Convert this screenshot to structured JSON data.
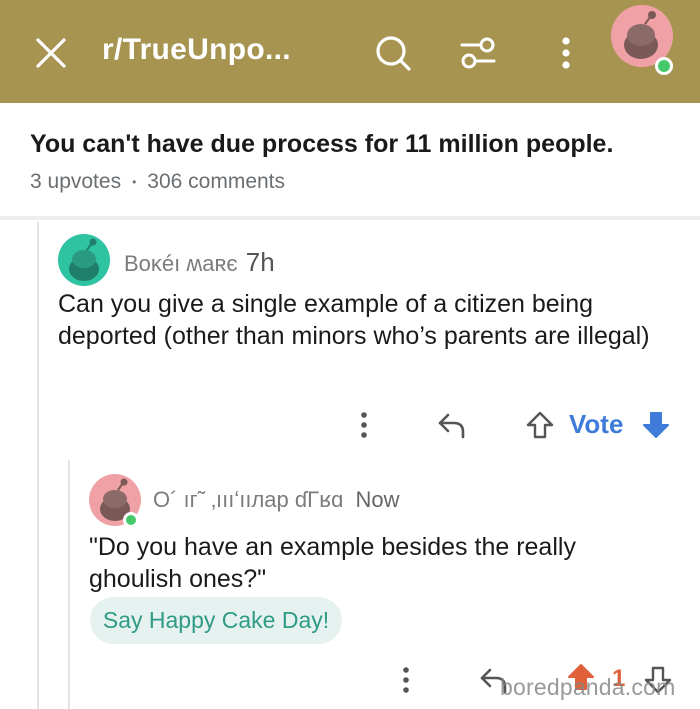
{
  "header": {
    "title": "r/TrueUnpo...",
    "close_icon": "close-icon",
    "search_icon": "search-icon",
    "filter_icon": "filter-icon",
    "more_icon": "more-vertical-icon",
    "bg_color": "#a69450"
  },
  "post": {
    "title": "You can't have due process for 11 million people.",
    "upvotes": "3 upvotes",
    "separator": "•",
    "comments": "306 comments"
  },
  "comment1": {
    "author": "Boĸéı ʍаʀє",
    "time": "7h",
    "text": "Can you give a single example of a citizen being deported (other than minors who’s parents are illegal)",
    "vote_label": "Vote",
    "avatar_color": "#2ec3a1"
  },
  "comment2": {
    "author": "O´ ıг˜  ‚ıııʻııлар ɗΓʁɑ",
    "time": "Now",
    "text": "\"Do you have an example besides the really ghoulish ones?\"",
    "cake_day": "Say Happy Cake Day!",
    "score": "1",
    "avatar_color": "#f0a1a6"
  },
  "watermark": "boredpanda.com"
}
